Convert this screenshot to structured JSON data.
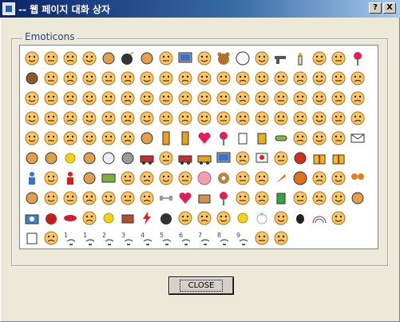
{
  "window": {
    "title": "-- 웹 페이지 대화 상자",
    "help_label": "?",
    "close_label": "X"
  },
  "group": {
    "label": "Emoticons"
  },
  "emoticons": {
    "rows": 10,
    "columns": 18,
    "palette": {
      "face": "#f6c86a",
      "face_edge": "#b07020",
      "heart": "#e0205a",
      "blue": "#3a70d0",
      "green": "#3aa040",
      "gray": "#9a9a9a",
      "brown": "#8a5a2a"
    },
    "cells": [
      [
        "face",
        "face",
        "face",
        "face",
        "food",
        "bomb",
        "party",
        "face",
        "tv",
        "face",
        "bear",
        "ball",
        "face",
        "gun",
        "candle",
        "face",
        "face",
        "rose"
      ],
      [
        "poop",
        "face",
        "face",
        "face",
        "face",
        "face",
        "face",
        "face",
        "face",
        "face",
        "face",
        "face",
        "face",
        "face",
        "face",
        "face",
        "face",
        "face"
      ],
      [
        "face",
        "face",
        "face",
        "face",
        "face",
        "face",
        "face",
        "face",
        "face",
        "face",
        "face",
        "face",
        "face",
        "face",
        "face",
        "face",
        "face",
        "face"
      ],
      [
        "face",
        "face",
        "face",
        "face",
        "face",
        "face",
        "face",
        "face",
        "face",
        "face",
        "face",
        "face",
        "face",
        "face",
        "face",
        "face",
        "face",
        "face"
      ],
      [
        "face",
        "face",
        "face",
        "face",
        "face",
        "face",
        "clock",
        "phone",
        "mobile",
        "heart",
        "flowers",
        "coffee",
        "beer",
        "pill",
        "face",
        "face",
        "face",
        "mail"
      ],
      [
        "pencil",
        "cake",
        "sun",
        "picture",
        "snowman",
        "rock",
        "car",
        "face",
        "car2",
        "bus",
        "computer",
        "face",
        "flag",
        "face",
        "devil",
        "gift",
        "gift"
      ],
      [
        "person",
        "face",
        "person2",
        "food",
        "money",
        "face",
        "face",
        "face",
        "face",
        "pig",
        "donut",
        "face",
        "face",
        "carrot",
        "ball2",
        "face",
        "face",
        "butterfly"
      ],
      [
        "food",
        "face",
        "face",
        "face",
        "face",
        "face",
        "face",
        "dumbbell",
        "heart2",
        "bread",
        "rose2",
        "face",
        "face",
        "bottle",
        "face",
        "face",
        "face",
        "candy"
      ],
      [
        "camera",
        "apple",
        "lips",
        "face",
        "star",
        "brick",
        "bolt",
        "cat",
        "face",
        "face",
        "face",
        "bulb",
        "ring",
        "face",
        "bug",
        "rainbow",
        "face"
      ],
      [
        "tissue",
        "face",
        "num1",
        "num1",
        "num2",
        "num3",
        "num4",
        "num5",
        "num6",
        "num7",
        "num8",
        "num9",
        "face",
        "face"
      ]
    ]
  },
  "buttons": {
    "close_label": "CLOSE"
  }
}
